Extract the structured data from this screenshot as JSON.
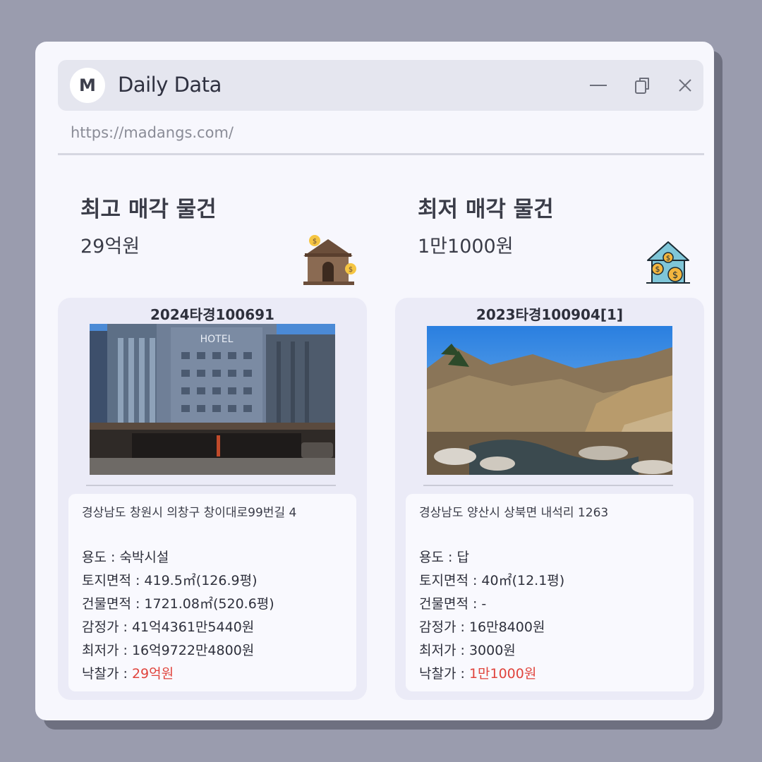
{
  "app": {
    "logo_letter": "M",
    "title": "Daily Data",
    "url": "https://madangs.com/"
  },
  "highest": {
    "label": "최고 매각 물건",
    "value": "29억원",
    "icon": "house-money-icon",
    "case_no": "2024타경100691",
    "photo": "hotel-building-photo",
    "address": "경상남도 창원시 의창구 창이대로99번길 4",
    "rows": [
      {
        "key": "용도",
        "val": "숙박시설"
      },
      {
        "key": "토지면적",
        "val": "419.5㎡(126.9평)"
      },
      {
        "key": "건물면적",
        "val": "1721.08㎡(520.6평)"
      },
      {
        "key": "감정가",
        "val": "41억4361만5440원"
      },
      {
        "key": "최저가",
        "val": "16억9722만4800원"
      },
      {
        "key": "낙찰가",
        "val": "29억원"
      }
    ]
  },
  "lowest": {
    "label": "최저 매각 물건",
    "value": "1만1000원",
    "icon": "house-coins-icon",
    "case_no": "2023타경100904[1]",
    "photo": "mountain-stream-photo",
    "address": "경상남도 양산시 상북면 내석리 1263",
    "rows": [
      {
        "key": "용도",
        "val": "답"
      },
      {
        "key": "토지면적",
        "val": "40㎡(12.1평)"
      },
      {
        "key": "건물면적",
        "val": "-"
      },
      {
        "key": "감정가",
        "val": "16만8400원"
      },
      {
        "key": "최저가",
        "val": "3000원"
      },
      {
        "key": "낙찰가",
        "val": "1만1000원"
      }
    ]
  },
  "colors": {
    "background": "#9a9cae",
    "window": "#f7f7fd",
    "card": "#ebebf7",
    "winning_bid": "#e0443d"
  }
}
